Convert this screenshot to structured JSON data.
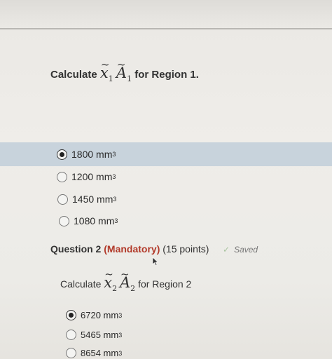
{
  "question1": {
    "prompt_prefix": "Calculate",
    "symbol_x": "x",
    "symbol_a": "A",
    "subscript": "1",
    "prompt_suffix": "for Region 1.",
    "options": [
      {
        "value": "1800",
        "unit": "mm",
        "exp": "3",
        "selected": true
      },
      {
        "value": "1200",
        "unit": "mm",
        "exp": "3",
        "selected": false
      },
      {
        "value": "1450",
        "unit": "mm",
        "exp": "3",
        "selected": false
      },
      {
        "value": "1080",
        "unit": "mm",
        "exp": "3",
        "selected": false
      }
    ]
  },
  "question2": {
    "heading_prefix": "Question 2",
    "mandatory": "(Mandatory)",
    "points": "(15 points)",
    "status": "Saved",
    "prompt_prefix": "Calculate",
    "symbol_x": "x",
    "symbol_a": "A",
    "subscript": "2",
    "prompt_suffix": "for Region 2",
    "options": [
      {
        "value": "6720",
        "unit": "mm",
        "exp": "3",
        "selected": true
      },
      {
        "value": "5465",
        "unit": "mm",
        "exp": "3",
        "selected": false
      },
      {
        "value": "8654",
        "unit": "mm",
        "exp": "3",
        "selected": false
      }
    ]
  },
  "colors": {
    "selected_band": "#c8d3dc",
    "mandatory": "#b23a2a",
    "saved_check": "#a9c4a0"
  },
  "icons": {
    "saved": "check-icon",
    "cursor": "mouse-pointer-icon"
  }
}
